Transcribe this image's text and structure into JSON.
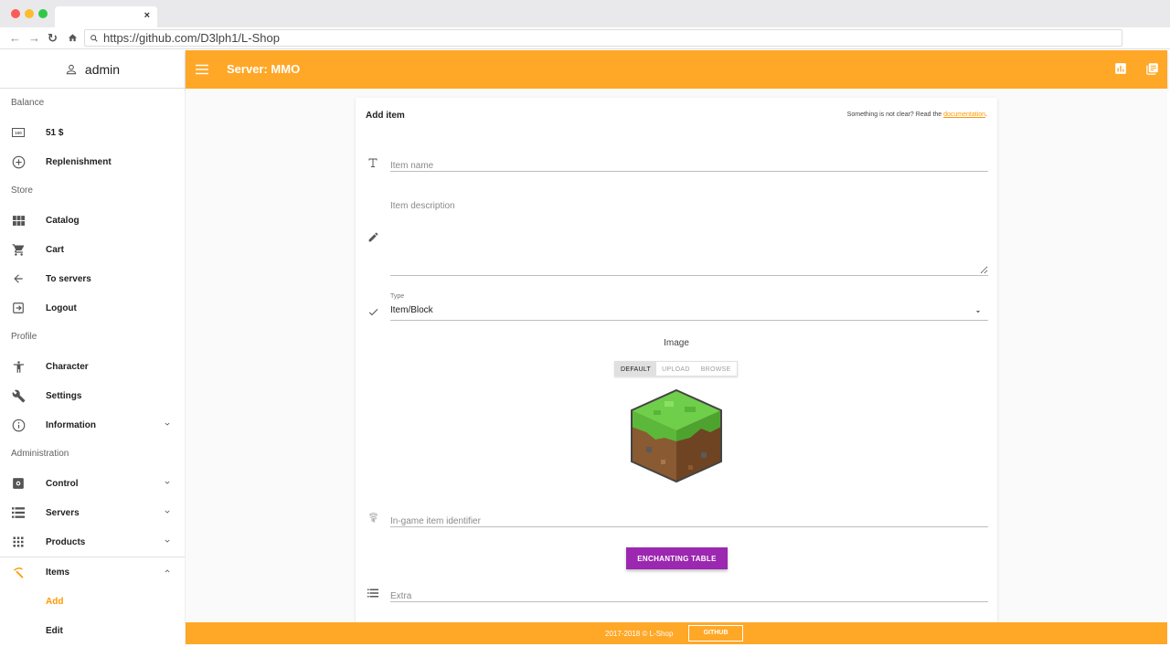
{
  "browser": {
    "url": "https://github.com/D3lph1/L-Shop",
    "tab_close": "×"
  },
  "sidebar": {
    "user": "admin",
    "sections": {
      "balance": "Balance",
      "store": "Store",
      "profile": "Profile",
      "administration": "Administration"
    },
    "items": {
      "balance_amount": "51 $",
      "replenishment": "Replenishment",
      "catalog": "Catalog",
      "cart": "Cart",
      "to_servers": "To servers",
      "logout": "Logout",
      "character": "Character",
      "settings": "Settings",
      "information": "Information",
      "control": "Control",
      "servers": "Servers",
      "products": "Products",
      "items": "Items",
      "add": "Add",
      "edit": "Edit"
    }
  },
  "appbar": {
    "title": "Server: MMO"
  },
  "form": {
    "title": "Add item",
    "help_text": "Something is not clear? Read the ",
    "help_link": "documentation",
    "help_end": ".",
    "item_name_placeholder": "Item name",
    "item_description_placeholder": "Item description",
    "type_label": "Type",
    "type_value": "Item/Block",
    "image_label": "Image",
    "image_tabs": [
      "DEFAULT",
      "UPLOAD",
      "BROWSE"
    ],
    "identifier_placeholder": "In-game item identifier",
    "enchant_button": "ENCHANTING TABLE",
    "extra_placeholder": "Extra"
  },
  "footer": {
    "text": "2017-2018 © L-Shop",
    "github": "GITHUB"
  },
  "colors": {
    "accent": "#ffa726",
    "purple": "#9c27b0"
  }
}
